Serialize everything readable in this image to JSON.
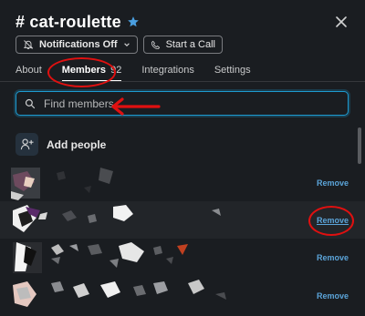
{
  "header": {
    "channel_name": "# cat-roulette",
    "starred": true
  },
  "actions": {
    "notifications_label": "Notifications Off",
    "call_label": "Start a Call"
  },
  "tabs": [
    {
      "label": "About"
    },
    {
      "label": "Members",
      "count": "92",
      "active": true
    },
    {
      "label": "Integrations"
    },
    {
      "label": "Settings"
    }
  ],
  "search": {
    "placeholder": "Find members",
    "value": ""
  },
  "add_people": {
    "label": "Add people"
  },
  "members": [
    {
      "remove_label": "Remove"
    },
    {
      "remove_label": "Remove",
      "hovered": true
    },
    {
      "remove_label": "Remove"
    },
    {
      "remove_label": "Remove"
    }
  ],
  "colors": {
    "accent": "#1d9bd1",
    "link": "#5ba4d9",
    "annotation": "#e01010",
    "background": "#1a1d21",
    "star": "#4a9fe0"
  }
}
